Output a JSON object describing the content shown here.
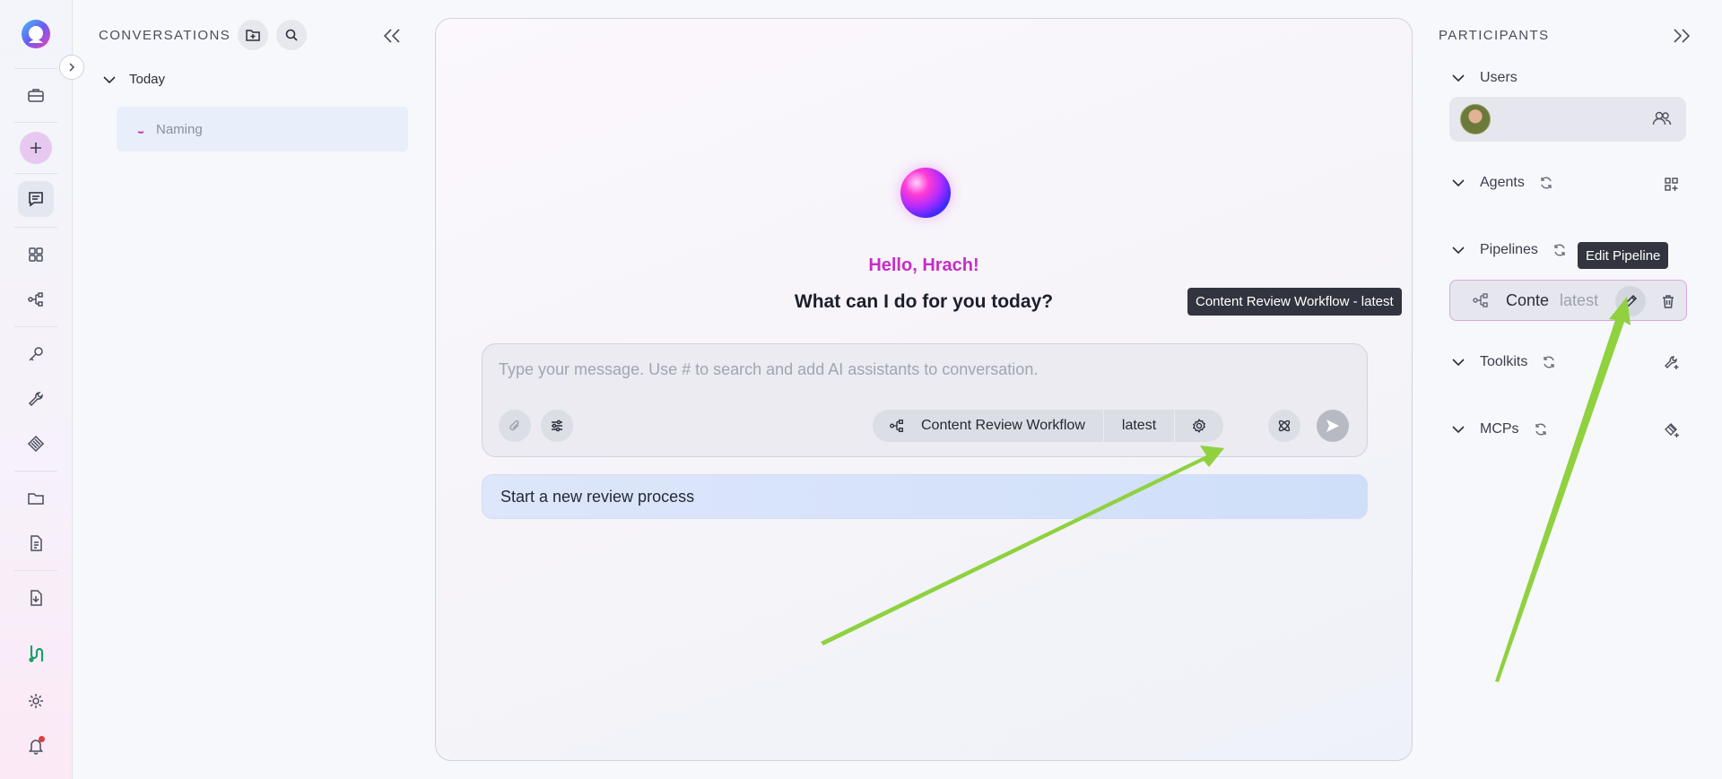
{
  "sidebar": {
    "icons": [
      "app-logo-icon",
      "briefcase-icon",
      "plus-icon",
      "chat-icon",
      "grid-icon",
      "pipeline-icon",
      "key-icon",
      "wrench-icon",
      "prompt-icon",
      "folder-icon",
      "document-icon",
      "import-icon",
      "tools-icon",
      "settings-icon",
      "bell-icon"
    ]
  },
  "conversations": {
    "title": "CONVERSATIONS",
    "group_label": "Today",
    "items": [
      {
        "label": "Naming"
      }
    ]
  },
  "chat": {
    "greeting": "Hello, Hrach!",
    "question": "What can I do for you today?",
    "input": {
      "placeholder": "Type your message. Use # to search and add AI assistants to conversation.",
      "value": ""
    },
    "pipeline_chip": {
      "name": "Content Review Workflow",
      "version": "latest"
    },
    "suggestion": "Start a new review process",
    "tooltip": "Content Review Workflow - latest"
  },
  "participants": {
    "title": "PARTICIPANTS",
    "sections": {
      "users": "Users",
      "agents": "Agents",
      "pipelines": "Pipelines",
      "toolkits": "Toolkits",
      "mcps": "MCPs"
    },
    "pipeline_card": {
      "name": "Conte",
      "version": "latest"
    },
    "edit_tooltip": "Edit Pipeline"
  },
  "colors": {
    "accent": "#c42fc6",
    "annotation_arrow": "#8fd13f",
    "tooltip_bg": "#32353f",
    "suggestion_bg": "#d6e2fa"
  }
}
